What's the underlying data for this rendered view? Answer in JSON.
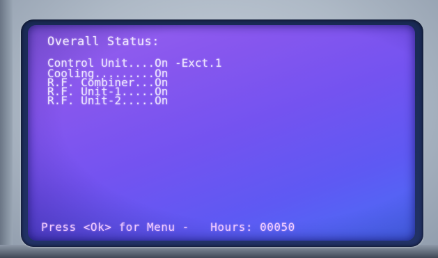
{
  "screen": {
    "title": "Overall Status:",
    "status_rows": [
      "Control Unit....On -Exct.1",
      "Cooling.........On",
      "R.F. Combiner...On",
      "R.F. Unit-1.....On",
      "R.F. Unit-2.....On"
    ],
    "footer_prompt": "Press <Ok> for Menu -",
    "hours_label": "Hours:",
    "hours_value": "00050"
  }
}
